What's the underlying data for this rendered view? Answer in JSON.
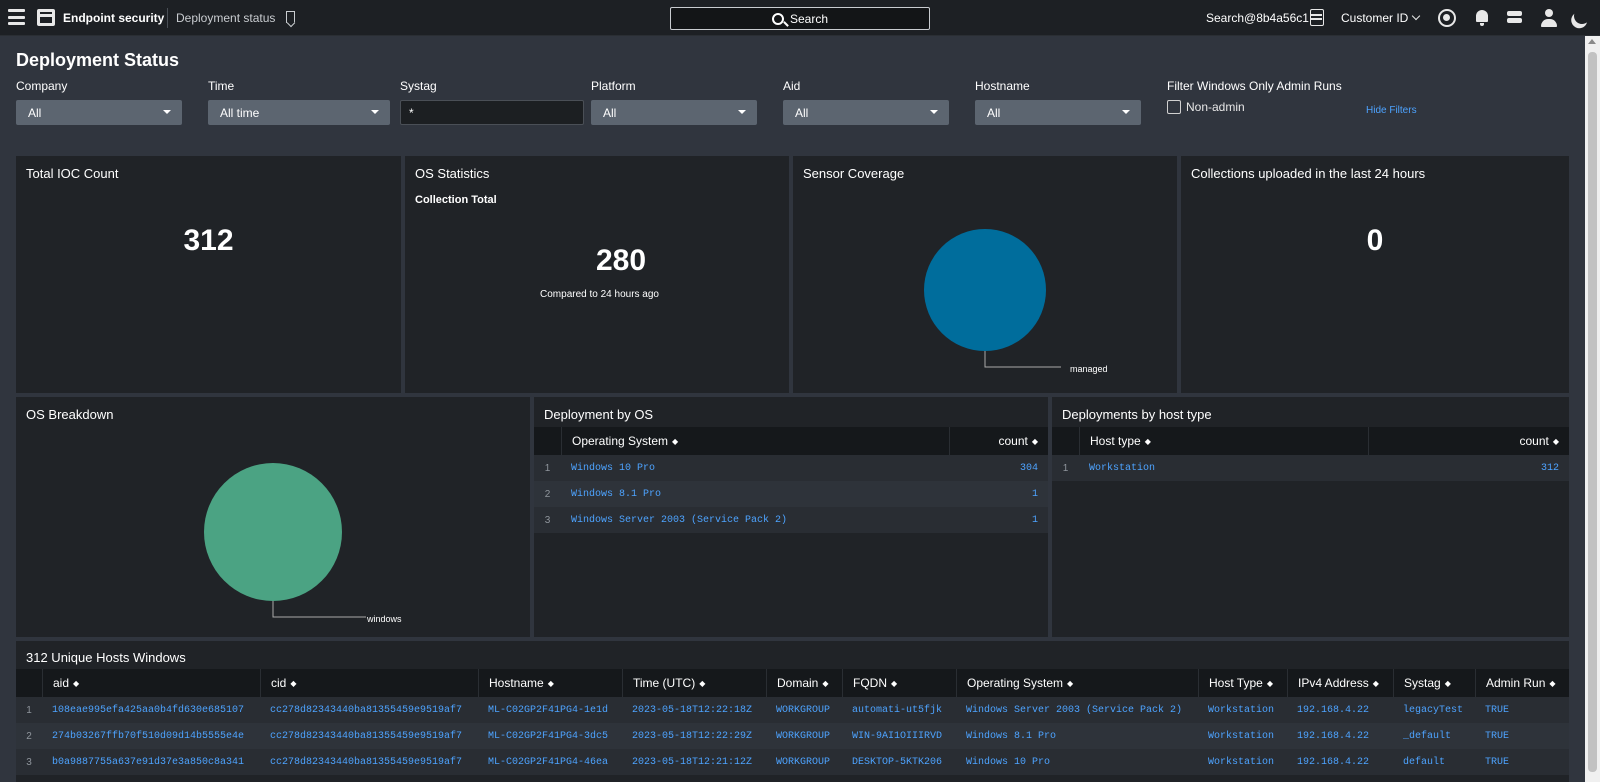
{
  "topbar": {
    "app_title": "Endpoint security",
    "crumb": "Deployment status",
    "search_label": "Search",
    "user": "Search@8b4a56c1",
    "customer_label": "Customer ID"
  },
  "page": {
    "title": "Deployment Status"
  },
  "filters": {
    "company": {
      "label": "Company",
      "value": "All"
    },
    "time": {
      "label": "Time",
      "value": "All time"
    },
    "systag": {
      "label": "Systag",
      "value": "*"
    },
    "platform": {
      "label": "Platform",
      "value": "All"
    },
    "aid": {
      "label": "Aid",
      "value": "All"
    },
    "hostname": {
      "label": "Hostname",
      "value": "All"
    },
    "windows_admin": {
      "label": "Filter Windows Only Admin Runs",
      "checkbox_label": "Non-admin"
    },
    "hide_filters": "Hide Filters"
  },
  "panels": {
    "ioc": {
      "title": "Total IOC Count",
      "value": "312"
    },
    "os_stats": {
      "title": "OS Statistics",
      "subtitle": "Collection Total",
      "value": "280",
      "compare": "Compared to 24 hours ago"
    },
    "sensor": {
      "title": "Sensor Coverage",
      "pie_label": "managed",
      "pie_color": "#006d9c"
    },
    "collections": {
      "title": "Collections uploaded in the last 24 hours",
      "value": "0"
    },
    "os_breakdown": {
      "title": "OS Breakdown",
      "pie_label": "windows",
      "pie_color": "#4ba383"
    }
  },
  "deploy_by_os": {
    "title": "Deployment by OS",
    "columns": [
      "Operating System",
      "count"
    ],
    "rows": [
      {
        "n": "1",
        "os": "Windows 10 Pro",
        "count": "304"
      },
      {
        "n": "2",
        "os": "Windows 8.1 Pro",
        "count": "1"
      },
      {
        "n": "3",
        "os": "Windows Server 2003 (Service Pack 2)",
        "count": "1"
      }
    ]
  },
  "deploy_by_host": {
    "title": "Deployments by host type",
    "columns": [
      "Host type",
      "count"
    ],
    "rows": [
      {
        "n": "1",
        "type": "Workstation",
        "count": "312"
      }
    ]
  },
  "hosts": {
    "title": "312 Unique Hosts Windows",
    "columns": [
      "aid",
      "cid",
      "Hostname",
      "Time (UTC)",
      "Domain",
      "FQDN",
      "Operating System",
      "Host Type",
      "IPv4 Address",
      "Systag",
      "Admin Run"
    ],
    "rows": [
      {
        "n": "1",
        "aid": "108eae995efa425aa0b4fd630e685107",
        "cid": "cc278d82343440ba81355459e9519af7",
        "hostname": "ML-C02GP2F41PG4-1e1d",
        "time": "2023-05-18T12:22:18Z",
        "domain": "WORKGROUP",
        "fqdn": "automati-ut5fjk",
        "os": "Windows Server 2003 (Service Pack 2)",
        "host_type": "Workstation",
        "ipv4": "192.168.4.22",
        "systag": "legacyTest",
        "admin": "TRUE"
      },
      {
        "n": "2",
        "aid": "274b03267ffb70f510d09d14b5555e4e",
        "cid": "cc278d82343440ba81355459e9519af7",
        "hostname": "ML-C02GP2F41PG4-3dc5",
        "time": "2023-05-18T12:22:29Z",
        "domain": "WORKGROUP",
        "fqdn": "WIN-9AI1OIIIRVD",
        "os": "Windows 8.1 Pro",
        "host_type": "Workstation",
        "ipv4": "192.168.4.22",
        "systag": "_default",
        "admin": "TRUE"
      },
      {
        "n": "3",
        "aid": "b0a9887755a637e91d37e3a850c8a341",
        "cid": "cc278d82343440ba81355459e9519af7",
        "hostname": "ML-C02GP2F41PG4-46ea",
        "time": "2023-05-18T12:21:12Z",
        "domain": "WORKGROUP",
        "fqdn": "DESKTOP-5KTK206",
        "os": "Windows 10 Pro",
        "host_type": "Workstation",
        "ipv4": "192.168.4.22",
        "systag": "default",
        "admin": "TRUE"
      }
    ]
  }
}
